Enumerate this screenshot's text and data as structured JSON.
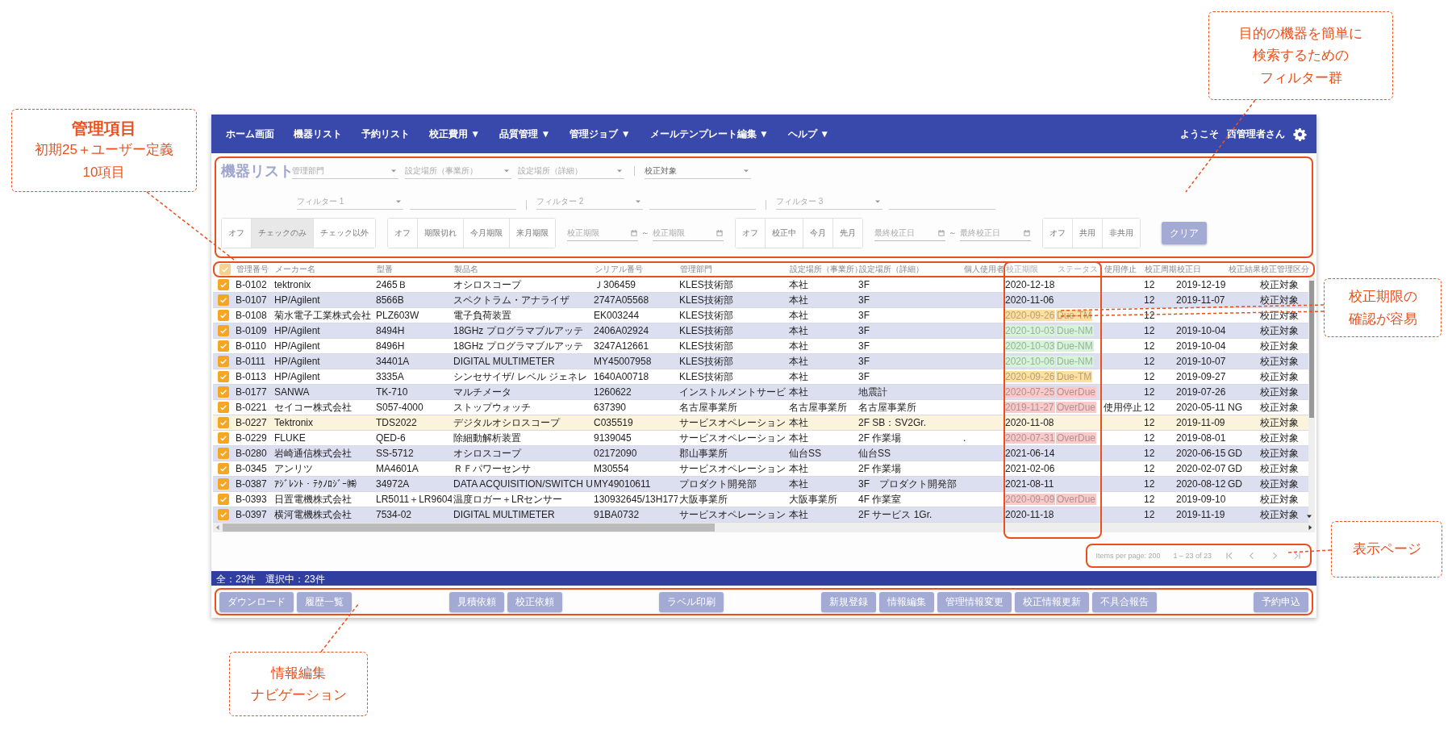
{
  "nav": {
    "items": [
      "ホーム画面",
      "機器リスト",
      "予約リスト",
      "校正費用 ▼",
      "品質管理 ▼",
      "管理ジョブ ▼",
      "メールテンプレート編集 ▼",
      "ヘルプ ▼"
    ],
    "welcome": "ようこそ",
    "user": "西管理者さん"
  },
  "filters": {
    "title": "機器リスト",
    "row1": [
      [
        {
          "kind": "select",
          "label": "管理部門"
        },
        {
          "kind": "select",
          "label": "設定場所（事業所）"
        },
        {
          "kind": "select",
          "label": "設定場所（詳細）"
        }
      ],
      [
        {
          "kind": "select",
          "value": "校正対象"
        }
      ]
    ],
    "row2": [
      [
        {
          "kind": "select",
          "label": "フィルター 1"
        },
        {
          "kind": "input"
        }
      ],
      [
        {
          "kind": "select",
          "label": "フィルター 2"
        },
        {
          "kind": "input"
        }
      ],
      [
        {
          "kind": "select",
          "label": "フィルター 3"
        },
        {
          "kind": "input"
        }
      ]
    ],
    "row3": [
      {
        "kind": "toggle",
        "options": [
          {
            "label": "オフ",
            "selected": false
          },
          {
            "label": "チェックのみ",
            "selected": true
          },
          {
            "label": "チェック以外",
            "selected": false
          }
        ]
      },
      {
        "kind": "toggle",
        "options": [
          {
            "label": "オフ",
            "selected": false
          },
          {
            "label": "期限切れ",
            "selected": false
          },
          {
            "label": "今月期限",
            "selected": false
          },
          {
            "label": "来月期限",
            "selected": false
          }
        ]
      },
      {
        "kind": "date_range",
        "from": "校正期限",
        "separator": "～",
        "to": "校正期限"
      },
      {
        "kind": "toggle",
        "options": [
          {
            "label": "オフ",
            "selected": false
          },
          {
            "label": "校正中",
            "selected": false
          },
          {
            "label": "今月",
            "selected": false
          },
          {
            "label": "先月",
            "selected": false
          }
        ]
      },
      {
        "kind": "date_range",
        "from": "最終校正日",
        "separator": "～",
        "to": "最終校正日"
      },
      {
        "kind": "toggle",
        "options": [
          {
            "label": "オフ",
            "selected": false
          },
          {
            "label": "共用",
            "selected": false
          },
          {
            "label": "非共用",
            "selected": false
          }
        ]
      },
      {
        "kind": "button",
        "label": "クリア"
      }
    ]
  },
  "table": {
    "select_all": true,
    "columns": [
      "管理番号",
      "メーカー名",
      "型番",
      "製品名",
      "シリアル番号",
      "管理部門",
      "設定場所（事業所）",
      "設定場所（詳細）",
      "個人使用者",
      "校正期限",
      "ステータス",
      "使用停止",
      "校正周期",
      "校正日",
      "校正結果",
      "校正管理区分"
    ],
    "rows": [
      {
        "checked": true,
        "highlighted": false,
        "cells": [
          "B-0102",
          "tektronix",
          "2465Ｂ",
          "オシロスコープ",
          "Ｊ306459",
          "KLES技術部",
          "本社",
          "3F",
          null,
          "2020-12-18",
          null,
          null,
          "12",
          "2019-12-19",
          null,
          "校正対象"
        ]
      },
      {
        "checked": true,
        "highlighted": false,
        "cells": [
          "B-0107",
          "HP/Agilent",
          "8566B",
          "スペクトラム・アナライザ",
          "2747A05568",
          "KLES技術部",
          "本社",
          "3F",
          null,
          "2020-11-06",
          null,
          null,
          "12",
          "2019-11-07",
          null,
          "校正対象"
        ]
      },
      {
        "checked": true,
        "highlighted": false,
        "color": "#fde0a0",
        "cells": [
          "B-0108",
          "菊水電子工業株式会社",
          "PLZ603W",
          "電子負荷装置",
          "EK003244",
          "KLES技術部",
          "本社",
          "3F",
          null,
          "2020-09-26",
          "Due-TM",
          null,
          "12",
          null,
          null,
          "校正対象"
        ]
      },
      {
        "checked": true,
        "highlighted": false,
        "color": "#d6f4d8",
        "cells": [
          "B-0109",
          "HP/Agilent",
          "8494H",
          "18GHz プログラマブルアッテ",
          "2406A02924",
          "KLES技術部",
          "本社",
          "3F",
          null,
          "2020-10-03",
          "Due-NM",
          null,
          "12",
          "2019-10-04",
          null,
          "校正対象"
        ]
      },
      {
        "checked": true,
        "highlighted": false,
        "color": "#d6f4d8",
        "cells": [
          "B-0110",
          "HP/Agilent",
          "8496H",
          "18GHz プログラマブルアッテ",
          "3247A12661",
          "KLES技術部",
          "本社",
          "3F",
          null,
          "2020-10-03",
          "Due-NM",
          null,
          "12",
          "2019-10-04",
          null,
          "校正対象"
        ]
      },
      {
        "checked": true,
        "highlighted": false,
        "color": "#d6f4d8",
        "cells": [
          "B-0111",
          "HP/Agilent",
          "34401A",
          "DIGITAL MULTIMETER",
          "MY45007958",
          "KLES技術部",
          "本社",
          "3F",
          null,
          "2020-10-06",
          "Due-NM",
          null,
          "12",
          "2019-10-07",
          null,
          "校正対象"
        ]
      },
      {
        "checked": true,
        "highlighted": false,
        "color": "#fde0a0",
        "cells": [
          "B-0113",
          "HP/Agilent",
          "3335A",
          "シンセサイザ/ レベル ジェネレ",
          "1640A00718",
          "KLES技術部",
          "本社",
          "3F",
          null,
          "2020-09-26",
          "Due-TM",
          null,
          "12",
          "2019-09-27",
          null,
          "校正対象"
        ]
      },
      {
        "checked": true,
        "highlighted": false,
        "color": "#f8caca",
        "cells": [
          "B-0177",
          "SANWA",
          "TK-710",
          "マルチメータ",
          "1260622",
          "インストルメントサービ",
          "本社",
          "地震計",
          null,
          "2020-07-25",
          "OverDue",
          null,
          "12",
          "2019-07-26",
          null,
          "校正対象"
        ]
      },
      {
        "checked": true,
        "highlighted": false,
        "color": "#f8caca",
        "cells": [
          "B-0221",
          "セイコー株式会社",
          "S057-4000",
          "ストップウォッチ",
          "637390",
          "名古屋事業所",
          "名古屋事業所",
          "名古屋事業所",
          null,
          "2019-11-27",
          "OverDue",
          "使用停止",
          "12",
          "2020-05-11",
          "NG",
          "校正対象"
        ]
      },
      {
        "checked": true,
        "highlighted": true,
        "cells": [
          "B-0227",
          "Tektronix",
          "TDS2022",
          "デジタルオシロスコープ",
          "C035519",
          "サービスオペレーション",
          "本社",
          "2F SB：SV2Gr.",
          null,
          "2020-11-08",
          null,
          null,
          "12",
          "2019-11-09",
          null,
          "校正対象"
        ]
      },
      {
        "checked": true,
        "highlighted": false,
        "color": "#f8caca",
        "cells": [
          "B-0229",
          "FLUKE",
          "QED-6",
          "除細動解析装置",
          "9139045",
          "サービスオペレーション",
          "本社",
          "2F 作業場",
          ".",
          "2020-07-31",
          "OverDue",
          null,
          "12",
          "2019-08-01",
          null,
          "校正対象"
        ]
      },
      {
        "checked": true,
        "highlighted": false,
        "cells": [
          "B-0280",
          "岩崎通信株式会社",
          "SS-5712",
          "オシロスコープ",
          "02172090",
          "郡山事業所",
          "仙台SS",
          "仙台SS",
          null,
          "2021-06-14",
          null,
          null,
          "12",
          "2020-06-15",
          "GD",
          "校正対象"
        ]
      },
      {
        "checked": true,
        "highlighted": false,
        "cells": [
          "B-0345",
          "アンリツ",
          "MA4601A",
          "ＲＦパワーセンサ",
          "M30554",
          "サービスオペレーション",
          "本社",
          "2F 作業場",
          null,
          "2021-02-06",
          null,
          null,
          "12",
          "2020-02-07",
          "GD",
          "校正対象"
        ]
      },
      {
        "checked": true,
        "highlighted": false,
        "cells": [
          "B-0387",
          "ｱｼﾞﾚﾝﾄ・ﾃｸﾉﾛｼﾞｰ㈱",
          "34972A",
          "DATA ACQUISITION/SWITCH U",
          "MY49010611",
          "プロダクト開発部",
          "本社",
          "3F　プロダクト開発部",
          null,
          "2021-08-11",
          null,
          null,
          "12",
          "2020-08-12",
          "GD",
          "校正対象"
        ]
      },
      {
        "checked": true,
        "highlighted": false,
        "color": "#f8caca",
        "cells": [
          "B-0393",
          "日置電機株式会社",
          "LR5011＋LR9604",
          "温度ロガー＋LRセンサー",
          "130932645/13H177",
          "大阪事業所",
          "大阪事業所",
          "4F 作業室",
          null,
          "2020-09-09",
          "OverDue",
          null,
          "12",
          "2019-09-10",
          null,
          "校正対象"
        ]
      },
      {
        "checked": true,
        "highlighted": false,
        "cells": [
          "B-0397",
          "横河電機株式会社",
          "7534-02",
          "DIGITAL MULTIMETER",
          "91BA0732",
          "サービスオペレーション",
          "本社",
          "2F サービス 1Gr.",
          null,
          "2020-11-18",
          null,
          null,
          "12",
          "2019-11-19",
          null,
          "校正対象"
        ]
      }
    ]
  },
  "pagination": {
    "items_per_page": "Items per page: 200",
    "range": "1 – 23 of 23"
  },
  "status_bar": "全：23件　選択中：23件",
  "actions": [
    [
      "ダウンロード",
      "履歴一覧"
    ],
    [
      "見積依頼",
      "校正依頼"
    ],
    [
      "ラベル印刷"
    ],
    [
      "新規登録",
      "情報編集",
      "管理情報変更",
      "校正情報更新",
      "不具合報告"
    ],
    [
      "予約申込"
    ]
  ],
  "callouts": [
    {
      "lines": [
        "目的の機器を簡単に",
        "検索するための",
        "フィルター群"
      ]
    },
    {
      "title": "管理項目",
      "lines": [
        "初期25＋ユーザー定義",
        "10項目"
      ]
    },
    {
      "lines": [
        "校正期限の",
        "確認が容易"
      ]
    },
    {
      "lines": [
        "表示ページ"
      ]
    },
    {
      "lines": [
        "情報編集",
        "ナビゲーション"
      ]
    }
  ]
}
